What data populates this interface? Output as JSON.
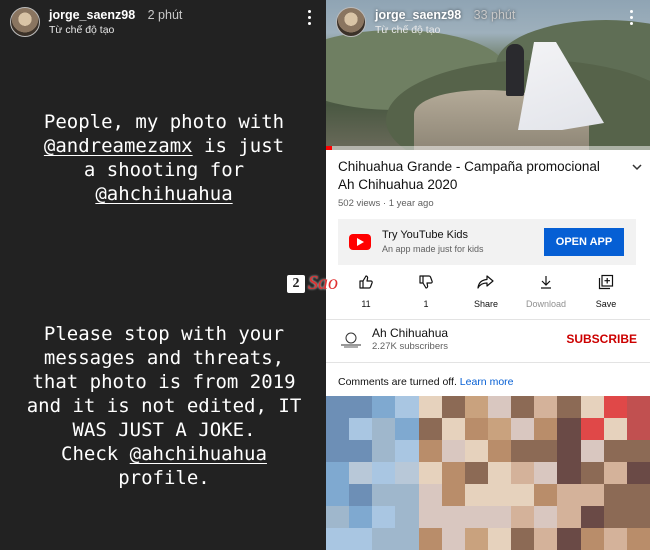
{
  "left_story": {
    "username": "jorge_saenz98",
    "time": "2 phút",
    "subtitle": "Từ chế độ tạo",
    "text1": {
      "line1": "People, my photo with",
      "mention1": "@andreamezamx",
      "line2_rest": " is just",
      "line3": "a shooting for",
      "mention2": "@ahchihuahua"
    },
    "text2": {
      "line1": "Please stop with your",
      "line2": "messages and threats,",
      "line3": "that photo is from 2019",
      "line4": "and it is not edited, IT",
      "line5": "WAS JUST A JOKE.",
      "line6_pre": "Check ",
      "mention": "@ahchihuahua",
      "line7": "profile."
    }
  },
  "right_story": {
    "username": "jorge_saenz98",
    "time": "33 phút",
    "subtitle": "Từ chế độ tạo",
    "video_progress_percent": 2,
    "video": {
      "title": "Chihuahua Grande - Campaña promocional Ah Chihuahua 2020",
      "views": "502 views",
      "age": "1 year ago",
      "separator": "·"
    },
    "ad": {
      "title": "Try YouTube Kids",
      "subtitle": "An app made just for kids",
      "button": "OPEN APP"
    },
    "actions": [
      {
        "icon": "thumbs-up-icon",
        "label": "11"
      },
      {
        "icon": "thumbs-down-icon",
        "label": "1"
      },
      {
        "icon": "share-icon",
        "label": "Share"
      },
      {
        "icon": "download-icon",
        "label": "Download"
      },
      {
        "icon": "save-playlist-icon",
        "label": "Save"
      }
    ],
    "channel": {
      "name": "Ah Chihuahua",
      "subscribers": "2.27K subscribers",
      "subscribe": "SUBSCRIBE"
    },
    "comments": {
      "text": "Comments are turned off.",
      "link": "Learn more"
    }
  },
  "watermark": {
    "box": "2",
    "text": "Sao"
  },
  "colors": {
    "story_bg": "#222222",
    "youtube_red": "#cc0000",
    "link_blue": "#065fd4"
  }
}
